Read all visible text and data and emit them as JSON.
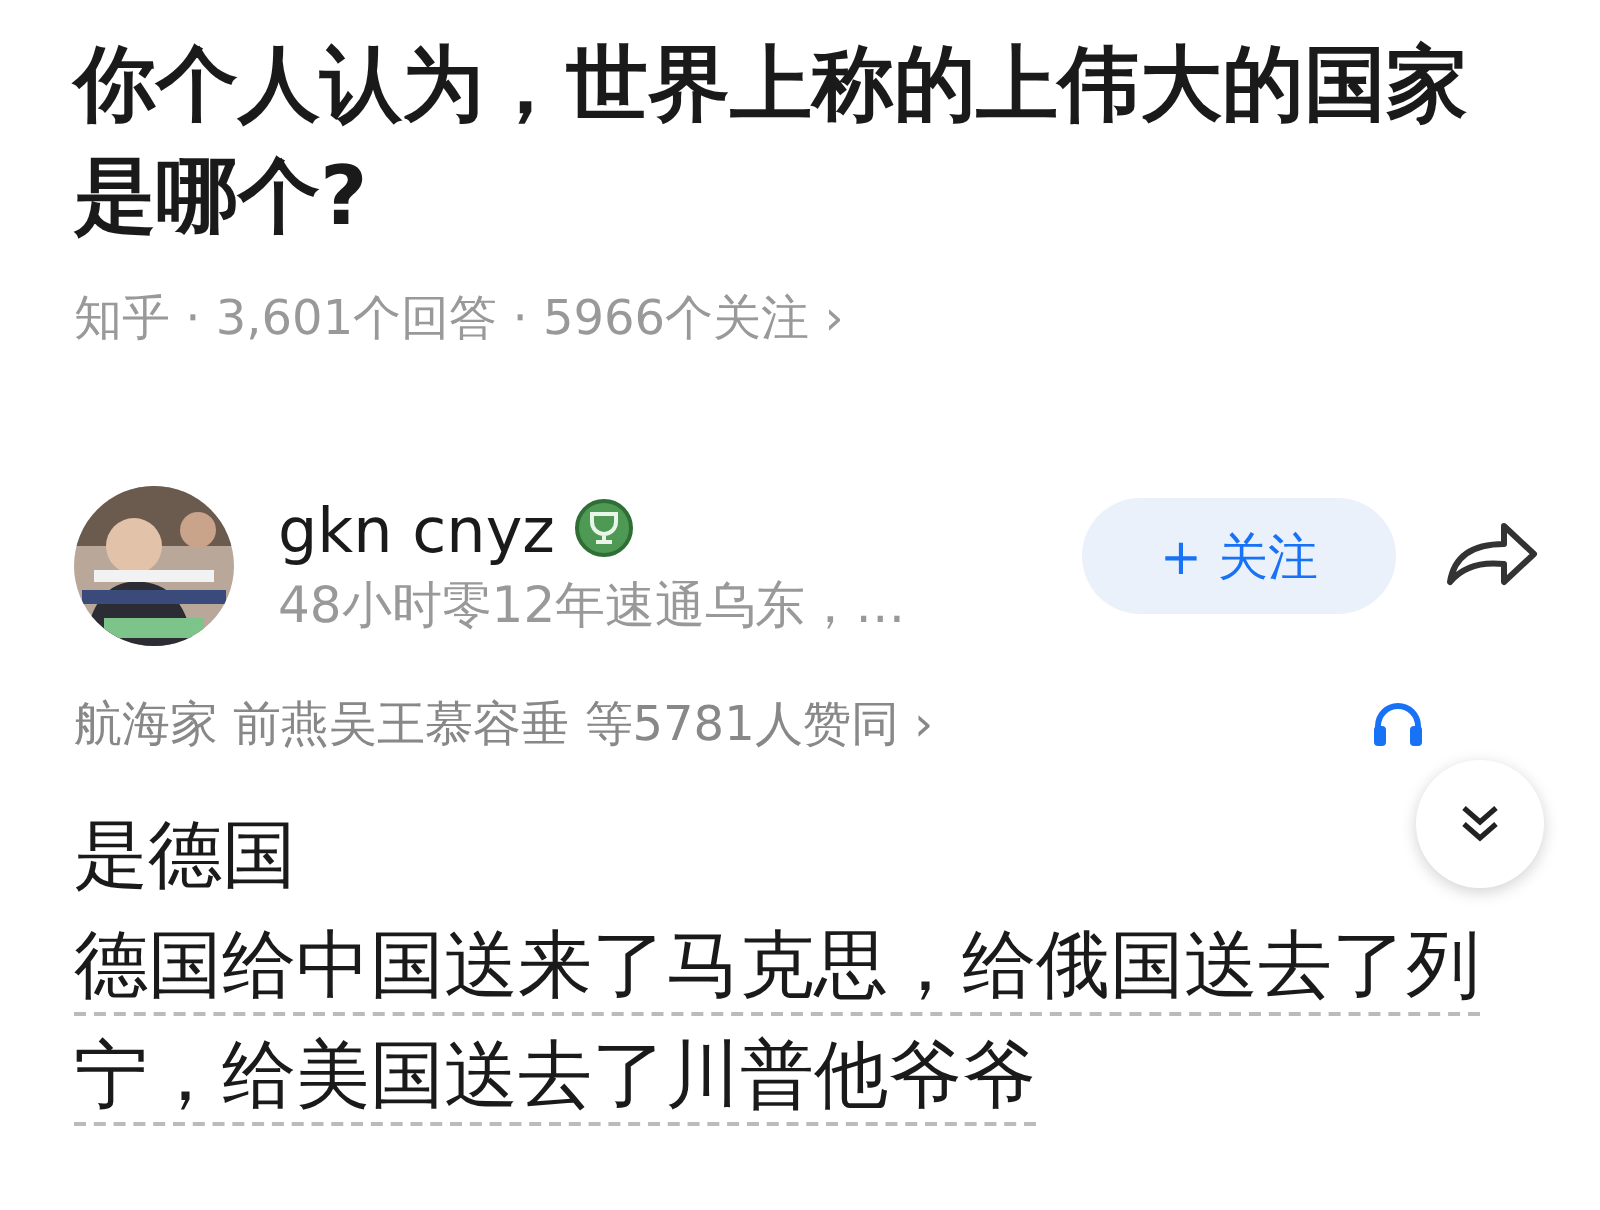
{
  "question": {
    "title": "你个人认为，世界上称的上伟大的国家是哪个?",
    "meta": "知乎 · 3,601个回答 · 5966个关注 ›"
  },
  "answer": {
    "author": {
      "name": "gkn cnyz",
      "bio": "48小时零12年速通乌东，…",
      "badge": true
    },
    "follow_button": "+ 关注",
    "votes": "航海家 前燕吴王慕容垂 等5781人赞同 ›",
    "paragraphs": [
      {
        "text": "是德国",
        "underlined": false
      },
      {
        "text": "德国给中国送来了马克思，给俄国送去了列宁，给美国送去了川普他爷爷",
        "underlined": true
      }
    ]
  }
}
